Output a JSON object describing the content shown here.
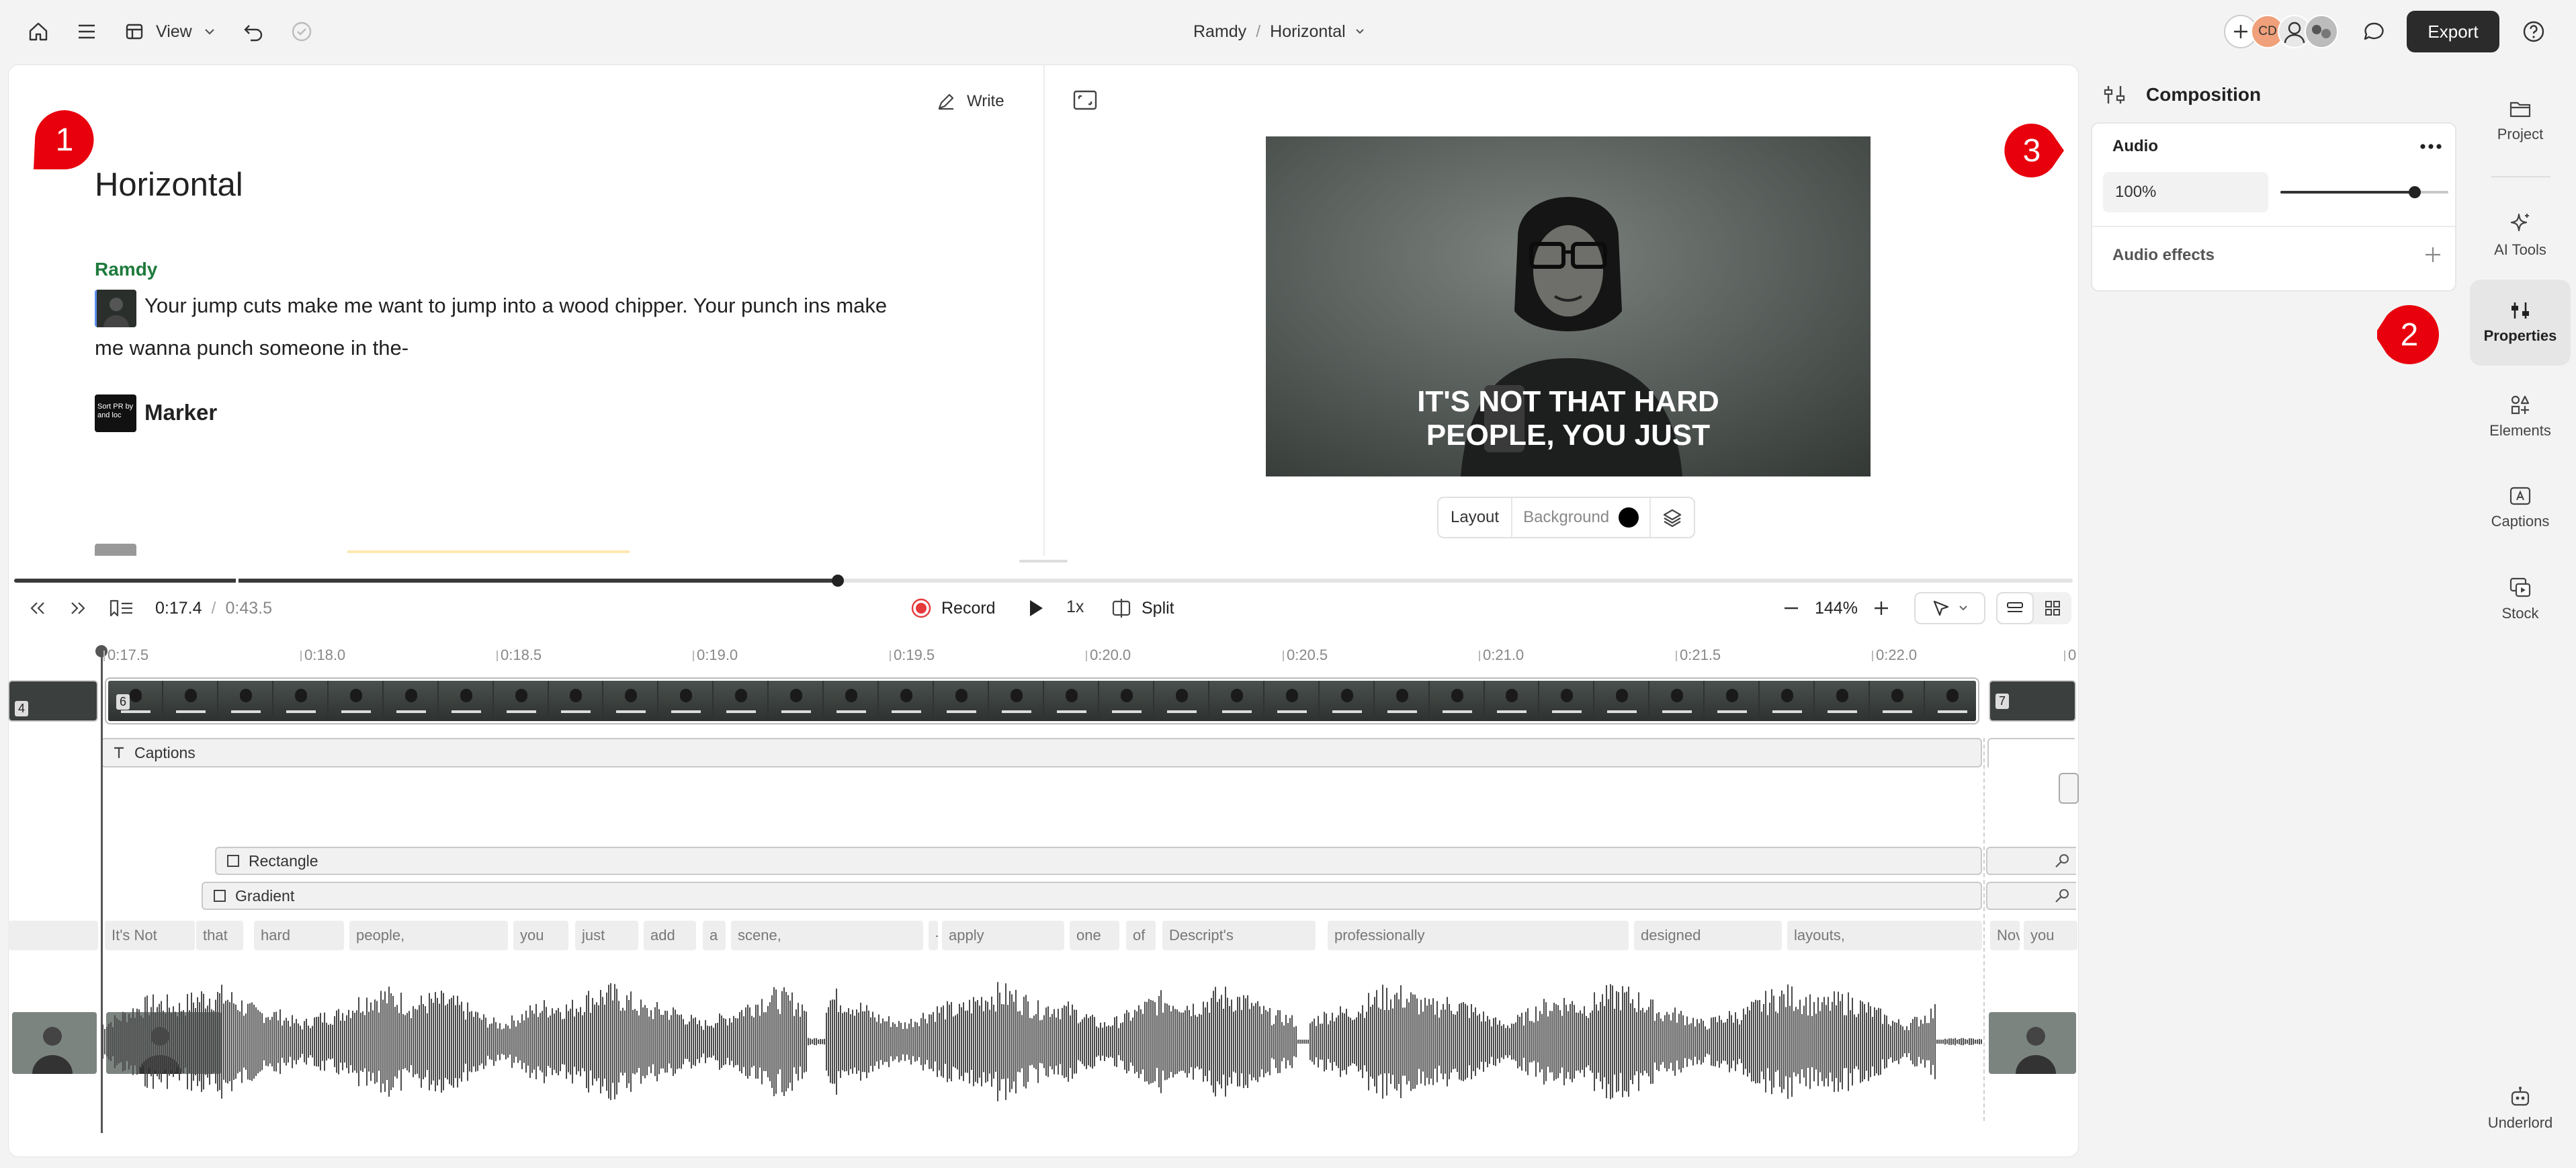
{
  "topbar": {
    "view_label": "View",
    "breadcrumb_project": "Ramdy",
    "breadcrumb_sep": "/",
    "breadcrumb_comp": "Horizontal",
    "avatar_initials": "CD",
    "export_label": "Export"
  },
  "script": {
    "write_label": "Write",
    "title": "Horizontal",
    "speaker": "Ramdy",
    "line1": "Your jump cuts make me want to jump into a wood chipper. Your punch ins make",
    "line2": "me wanna punch someone in the-",
    "marker_label": "Marker",
    "marker_thumb_text": "Sort PR by and loc"
  },
  "preview": {
    "caption_line1": "IT'S NOT THAT HARD",
    "caption_line2": "PEOPLE, YOU JUST",
    "layout_label": "Layout",
    "background_label": "Background"
  },
  "transport": {
    "current_time": "0:17.4",
    "sep": "/",
    "total_time": "0:43.5",
    "record_label": "Record",
    "speed_label": "1x",
    "split_label": "Split",
    "zoom_label": "144%",
    "playhead_fraction": 0.4
  },
  "ruler": {
    "ticks": [
      "0:17.5",
      "0:18.0",
      "0:18.5",
      "0:19.0",
      "0:19.5",
      "0:20.0",
      "0:20.5",
      "0:21.0",
      "0:21.5",
      "0:22.0",
      "0"
    ]
  },
  "tracks": {
    "clip_prev": "4",
    "clip_main": "6",
    "clip_next": "7",
    "captions_label": "Captions",
    "rectangle_label": "Rectangle",
    "gradient_label": "Gradient"
  },
  "words": [
    "It's Not",
    "that",
    "hard",
    "people,",
    "you",
    "just",
    "add",
    "a",
    "scene,",
    "-",
    "apply",
    "one",
    "of",
    "Descript's",
    "professionally",
    "designed",
    "layouts,",
    "Nov",
    "you"
  ],
  "composition": {
    "title": "Composition",
    "audio_label": "Audio",
    "audio_volume": "100%",
    "audio_slider_fraction": 0.8,
    "audio_effects_label": "Audio effects"
  },
  "rail": {
    "project": "Project",
    "ai_tools": "AI Tools",
    "properties": "Properties",
    "elements": "Elements",
    "captions": "Captions",
    "stock": "Stock",
    "underlord": "Underlord"
  },
  "annotations": {
    "badge1": "1",
    "badge2": "2",
    "badge3": "3",
    "badge_color": "#e8000d"
  },
  "colors": {
    "speaker_green": "#1e7a3c",
    "export_bg": "#2b2b2b",
    "record_red": "#e5393c"
  }
}
